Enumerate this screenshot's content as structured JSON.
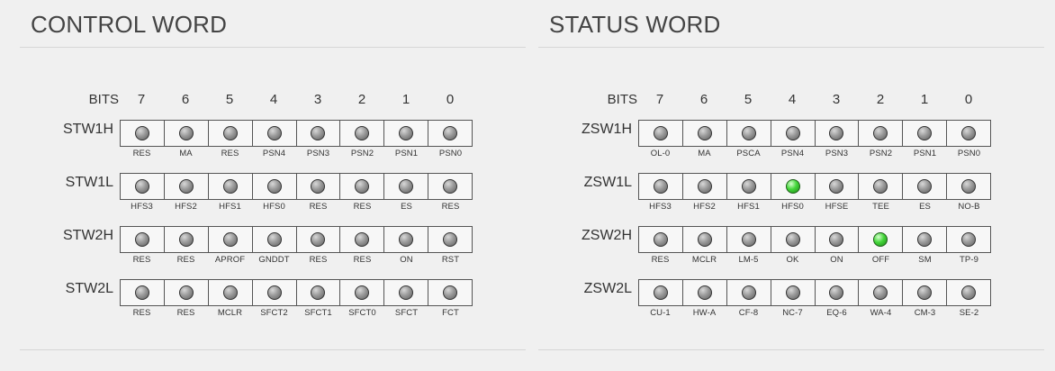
{
  "control": {
    "title": "CONTROL WORD",
    "bits_label": "BITS",
    "bit_numbers": [
      "7",
      "6",
      "5",
      "4",
      "3",
      "2",
      "1",
      "0"
    ],
    "rows": [
      {
        "name": "STW1H",
        "labels": [
          "RES",
          "MA",
          "RES",
          "PSN4",
          "PSN3",
          "PSN2",
          "PSN1",
          "PSN0"
        ],
        "leds": [
          false,
          false,
          false,
          false,
          false,
          false,
          false,
          false
        ]
      },
      {
        "name": "STW1L",
        "labels": [
          "HFS3",
          "HFS2",
          "HFS1",
          "HFS0",
          "RES",
          "RES",
          "ES",
          "RES"
        ],
        "leds": [
          false,
          false,
          false,
          false,
          false,
          false,
          false,
          false
        ]
      },
      {
        "name": "STW2H",
        "labels": [
          "RES",
          "RES",
          "APROF",
          "GNDDT",
          "RES",
          "RES",
          "ON",
          "RST"
        ],
        "leds": [
          false,
          false,
          false,
          false,
          false,
          false,
          false,
          false
        ]
      },
      {
        "name": "STW2L",
        "labels": [
          "RES",
          "RES",
          "MCLR",
          "SFCT2",
          "SFCT1",
          "SFCT0",
          "SFCT",
          "FCT"
        ],
        "leds": [
          false,
          false,
          false,
          false,
          false,
          false,
          false,
          false
        ]
      }
    ]
  },
  "status": {
    "title": "STATUS WORD",
    "bits_label": "BITS",
    "bit_numbers": [
      "7",
      "6",
      "5",
      "4",
      "3",
      "2",
      "1",
      "0"
    ],
    "rows": [
      {
        "name": "ZSW1H",
        "labels": [
          "OL-0",
          "MA",
          "PSCA",
          "PSN4",
          "PSN3",
          "PSN2",
          "PSN1",
          "PSN0"
        ],
        "leds": [
          false,
          false,
          false,
          false,
          false,
          false,
          false,
          false
        ]
      },
      {
        "name": "ZSW1L",
        "labels": [
          "HFS3",
          "HFS2",
          "HFS1",
          "HFS0",
          "HFSE",
          "TEE",
          "ES",
          "NO-B"
        ],
        "leds": [
          false,
          false,
          false,
          true,
          false,
          false,
          false,
          false
        ]
      },
      {
        "name": "ZSW2H",
        "labels": [
          "RES",
          "MCLR",
          "LM-5",
          "OK",
          "ON",
          "OFF",
          "SM",
          "TP-9"
        ],
        "leds": [
          false,
          false,
          false,
          false,
          false,
          true,
          false,
          false
        ]
      },
      {
        "name": "ZSW2L",
        "labels": [
          "CU-1",
          "HW-A",
          "CF-8",
          "NC-7",
          "EQ-6",
          "WA-4",
          "CM-3",
          "SE-2"
        ],
        "leds": [
          false,
          false,
          false,
          false,
          false,
          false,
          false,
          false
        ]
      }
    ]
  },
  "colors": {
    "led_off": "#8a8a8a",
    "led_on": "#3ccf33",
    "background": "#f0f0f0"
  }
}
